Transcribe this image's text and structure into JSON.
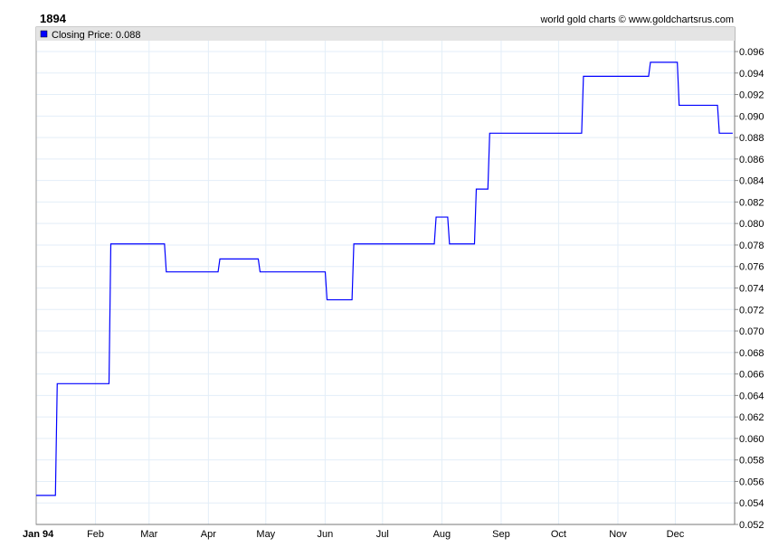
{
  "header": {
    "title": "1894",
    "credit": "world gold charts © www.goldchartsrus.com"
  },
  "legend": {
    "label": "Closing Price: 0.088",
    "color": "#0000ff"
  },
  "chart_data": {
    "type": "line",
    "title": "1894",
    "xlabel": "",
    "ylabel": "",
    "x_unit": "day of year",
    "xlim": [
      0,
      365
    ],
    "ylim": [
      0.052,
      0.096
    ],
    "grid": true,
    "legend_position": "top-left",
    "x_ticks": [
      {
        "label": "Jan 94",
        "day": 0
      },
      {
        "label": "Feb",
        "day": 31
      },
      {
        "label": "Mar",
        "day": 59
      },
      {
        "label": "Apr",
        "day": 90
      },
      {
        "label": "May",
        "day": 120
      },
      {
        "label": "Jun",
        "day": 151
      },
      {
        "label": "Jul",
        "day": 181
      },
      {
        "label": "Aug",
        "day": 212
      },
      {
        "label": "Sep",
        "day": 243
      },
      {
        "label": "Oct",
        "day": 273
      },
      {
        "label": "Nov",
        "day": 304
      },
      {
        "label": "Dec",
        "day": 334
      }
    ],
    "y_ticks": [
      "0.052",
      "0.054",
      "0.056",
      "0.058",
      "0.060",
      "0.062",
      "0.064",
      "0.066",
      "0.068",
      "0.070",
      "0.072",
      "0.074",
      "0.076",
      "0.078",
      "0.080",
      "0.082",
      "0.084",
      "0.086",
      "0.088",
      "0.090",
      "0.092",
      "0.094",
      "0.096"
    ],
    "series": [
      {
        "name": "Closing Price",
        "color": "#0000ff",
        "step": true,
        "points": [
          [
            0,
            0.0547
          ],
          [
            11,
            0.0651
          ],
          [
            39,
            0.0781
          ],
          [
            68,
            0.0755
          ],
          [
            96,
            0.0767
          ],
          [
            117,
            0.0755
          ],
          [
            152,
            0.0729
          ],
          [
            166,
            0.0781
          ],
          [
            209,
            0.0806
          ],
          [
            216,
            0.0781
          ],
          [
            230,
            0.0832
          ],
          [
            237,
            0.0884
          ],
          [
            286,
            0.0937
          ],
          [
            321,
            0.095
          ],
          [
            336,
            0.091
          ],
          [
            357,
            0.0884
          ],
          [
            364,
            0.0884
          ]
        ]
      }
    ]
  }
}
